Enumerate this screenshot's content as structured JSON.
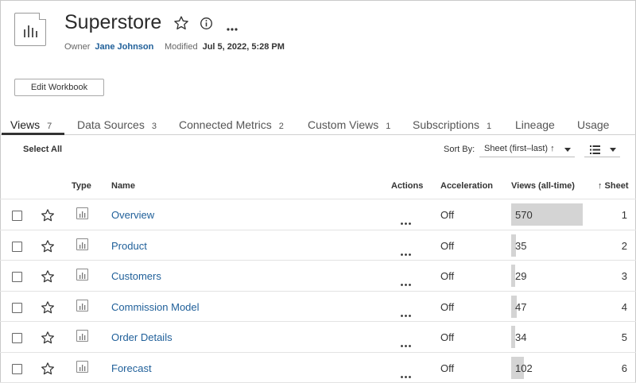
{
  "workbook": {
    "title": "Superstore",
    "owner_label": "Owner",
    "owner_name": "Jane Johnson",
    "modified_label": "Modified",
    "modified_value": "Jul 5, 2022, 5:28 PM",
    "edit_button": "Edit Workbook"
  },
  "tabs": [
    {
      "label": "Views",
      "count": "7",
      "active": true
    },
    {
      "label": "Data Sources",
      "count": "3"
    },
    {
      "label": "Connected Metrics",
      "count": "2"
    },
    {
      "label": "Custom Views",
      "count": "1"
    },
    {
      "label": "Subscriptions",
      "count": "1"
    },
    {
      "label": "Lineage",
      "count": ""
    },
    {
      "label": "Usage",
      "count": ""
    }
  ],
  "toolbar": {
    "select_all": "Select All",
    "sort_by_label": "Sort By:",
    "sort_value": "Sheet (first–last) ↑",
    "view_mode_icon": "list-view-icon"
  },
  "columns": {
    "type": "Type",
    "name": "Name",
    "actions": "Actions",
    "acceleration": "Acceleration",
    "views": "Views (all-time)",
    "sheet": "↑ Sheet"
  },
  "rows": [
    {
      "name": "Overview",
      "acceleration": "Off",
      "views": 570,
      "views_label": "570",
      "sheet": "1"
    },
    {
      "name": "Product",
      "acceleration": "Off",
      "views": 35,
      "views_label": "35",
      "sheet": "2"
    },
    {
      "name": "Customers",
      "acceleration": "Off",
      "views": 29,
      "views_label": "29",
      "sheet": "3"
    },
    {
      "name": "Commission Model",
      "acceleration": "Off",
      "views": 47,
      "views_label": "47",
      "sheet": "4"
    },
    {
      "name": "Order Details",
      "acceleration": "Off",
      "views": 34,
      "views_label": "34",
      "sheet": "5"
    },
    {
      "name": "Forecast",
      "acceleration": "Off",
      "views": 102,
      "views_label": "102",
      "sheet": "6"
    }
  ],
  "views_max": 570,
  "colors": {
    "link": "#1f5f99",
    "bar": "#d4d4d4",
    "active_tab_underline": "#333333"
  }
}
